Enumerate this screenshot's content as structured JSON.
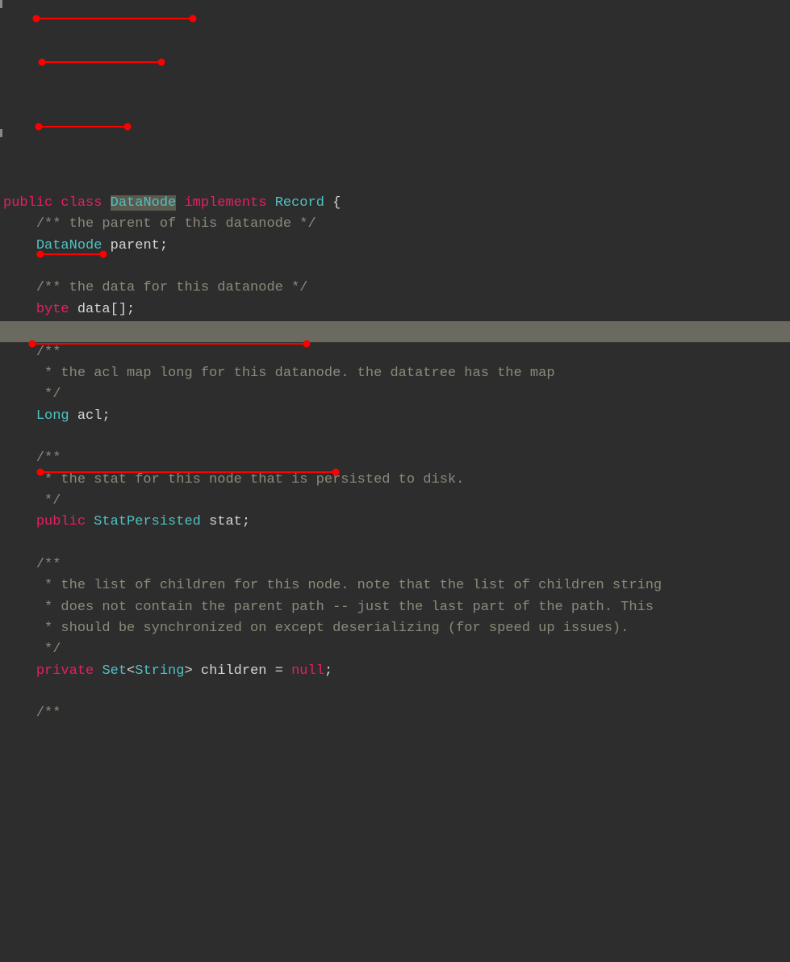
{
  "code": {
    "line1": {
      "kw_public": "public",
      "kw_class": "class",
      "class_name": "DataNode",
      "kw_implements": "implements",
      "iface": "Record",
      "brace": "{"
    },
    "line2_comment": "/** the parent of this datanode */",
    "line3": {
      "type": "DataNode",
      "name": "parent",
      "semi": ";"
    },
    "line5_comment": "/** the data for this datanode */",
    "line6": {
      "type": "byte",
      "name": "data",
      "brackets": "[]",
      "semi": ";"
    },
    "line8_c1": "/**",
    "line9_c2": " * the acl map long for this datanode. the datatree has the map",
    "line10_c3": " */",
    "line11": {
      "type": "Long",
      "name": "acl",
      "semi": ";"
    },
    "line13_c1": "/**",
    "line14_c2": " * the stat for this node that is persisted to disk.",
    "line15_c3": " */",
    "line16": {
      "kw_public": "public",
      "type": "StatPersisted",
      "name": "stat",
      "semi": ";"
    },
    "line18_c1": "/**",
    "line19_c2": " * the list of children for this node. note that the list of children string",
    "line20_c3": " * does not contain the parent path -- just the last part of the path. This",
    "line21_c4": " * should be synchronized on except deserializing (for speed up issues).",
    "line22_c5": " */",
    "line23": {
      "kw_private": "private",
      "type1": "Set",
      "lt": "<",
      "type2": "String",
      "gt": ">",
      "name": "children",
      "eq": "=",
      "null": "null",
      "semi": ";"
    },
    "line25_c1": "/**",
    "indent1": "    ",
    "indent_star": "     "
  },
  "colors": {
    "keyword": "#e91e63",
    "type": "#4fc1c1",
    "comment": "#8a8a7a",
    "bg": "#2d2d2d",
    "highlight": "#ff0000"
  }
}
